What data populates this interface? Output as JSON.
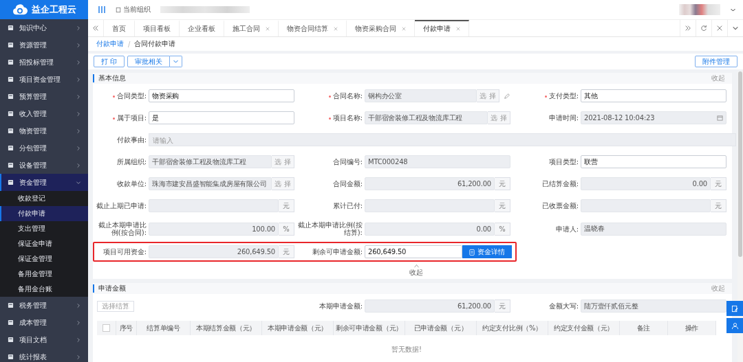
{
  "brand": {
    "name": "益企工程云"
  },
  "header": {
    "org_label": "当前组织"
  },
  "sidebar": {
    "items": [
      {
        "label": "知识中心",
        "expanded": false
      },
      {
        "label": "资源管理",
        "expanded": false
      },
      {
        "label": "招投标管理",
        "expanded": false
      },
      {
        "label": "项目资金管理",
        "expanded": false
      },
      {
        "label": "预算管理",
        "expanded": false
      },
      {
        "label": "收入管理",
        "expanded": false
      },
      {
        "label": "物资管理",
        "expanded": false
      },
      {
        "label": "分包管理",
        "expanded": false
      },
      {
        "label": "设备管理",
        "expanded": false
      },
      {
        "label": "资金管理",
        "expanded": true,
        "children": [
          {
            "label": "收款登记",
            "selected": false
          },
          {
            "label": "付款申请",
            "selected": true
          },
          {
            "label": "支出管理",
            "selected": false
          },
          {
            "label": "保证金申请",
            "selected": false
          },
          {
            "label": "保证金管理",
            "selected": false
          },
          {
            "label": "备用金管理",
            "selected": false
          },
          {
            "label": "备用金台账",
            "selected": false
          }
        ]
      },
      {
        "label": "税务管理",
        "expanded": false
      },
      {
        "label": "成本管理",
        "expanded": false
      },
      {
        "label": "项目文档",
        "expanded": false
      },
      {
        "label": "统计报表",
        "expanded": false
      }
    ]
  },
  "tabs": [
    {
      "label": "首页",
      "closable": false,
      "selected": false
    },
    {
      "label": "项目看板",
      "closable": false,
      "selected": false
    },
    {
      "label": "企业看板",
      "closable": false,
      "selected": false
    },
    {
      "label": "施工合同",
      "closable": true,
      "selected": false
    },
    {
      "label": "物资合同结算",
      "closable": true,
      "selected": false
    },
    {
      "label": "物资采购合同",
      "closable": true,
      "selected": false
    },
    {
      "label": "付款申请",
      "closable": true,
      "selected": true
    }
  ],
  "breadcrumb": {
    "items": [
      "付款申请",
      "合同付款申请"
    ],
    "separator": "/"
  },
  "toolbar": {
    "buttons": [
      "打 印",
      "审批相关"
    ],
    "attachment_button": "附件管理"
  },
  "basic_info": {
    "title": "基本信息",
    "collapse": "收起",
    "collapse_link": "收起",
    "rows": [
      {
        "highlighted": false,
        "fields": [
          {
            "kind": "text",
            "label": "合同类型:",
            "required": true,
            "value": "物资采购",
            "disabled": false
          },
          {
            "kind": "select",
            "label": "合同名称:",
            "required": true,
            "value": "钢构办公室",
            "disabled": true,
            "button": "选 择",
            "edit": true
          },
          {
            "kind": "text",
            "label": "支付类型:",
            "required": true,
            "value": "其他",
            "disabled": false
          }
        ]
      },
      {
        "highlighted": false,
        "fields": [
          {
            "kind": "text",
            "label": "属于项目:",
            "required": true,
            "value": "是",
            "disabled": false
          },
          {
            "kind": "select",
            "label": "项目名称:",
            "required": true,
            "value": "干部宿舍装修工程及物流库工程",
            "disabled": true,
            "button": "选 择"
          },
          {
            "kind": "date",
            "label": "申请时间:",
            "required": false,
            "value": "2021-08-12 10:04:23",
            "disabled": true
          }
        ]
      },
      {
        "highlighted": false,
        "fields": [
          {
            "kind": "textarea",
            "label": "付款事由:",
            "required": false,
            "placeholder": "请输入",
            "disabled": true
          }
        ]
      },
      {
        "highlighted": false,
        "fields": [
          {
            "kind": "select",
            "label": "所属组织:",
            "required": false,
            "value": "干部宿舍装修工程及物流库工程",
            "disabled": true,
            "button": "选 择"
          },
          {
            "kind": "text",
            "label": "合同编号:",
            "required": false,
            "value": "MTC000248",
            "disabled": true
          },
          {
            "kind": "text",
            "label": "项目类型:",
            "required": false,
            "value": "联营",
            "disabled": false
          }
        ]
      },
      {
        "highlighted": false,
        "fields": [
          {
            "kind": "select",
            "label": "收款单位:",
            "required": false,
            "value": "珠海市建安昌盛智能集成房屋有限公司",
            "disabled": true,
            "button": "选 择"
          },
          {
            "kind": "amount",
            "label": "合同金额:",
            "required": false,
            "value": "61,200.00",
            "unit": "元",
            "disabled": true
          },
          {
            "kind": "amount",
            "label": "已结算金额:",
            "required": false,
            "value": "0.00",
            "unit": "元",
            "disabled": true
          }
        ]
      },
      {
        "highlighted": false,
        "fields": [
          {
            "kind": "amount",
            "label": "截止上期已申请:",
            "required": false,
            "unit": "元",
            "disabled": true
          },
          {
            "kind": "amount",
            "label": "累计已付:",
            "required": false,
            "unit": "元",
            "disabled": true
          },
          {
            "kind": "amount",
            "label": "已收票金额:",
            "required": false,
            "unit": "元",
            "disabled": true
          }
        ]
      },
      {
        "highlighted": false,
        "fields": [
          {
            "kind": "amount",
            "label": "截止本期申请比例(按合同):",
            "required": false,
            "value": "100.00",
            "unit": "%",
            "disabled": true
          },
          {
            "kind": "amount",
            "label": "截止本期申请比例(按结算):",
            "required": false,
            "value": "0.00",
            "unit": "%",
            "disabled": true
          },
          {
            "kind": "text",
            "label": "申请人:",
            "required": false,
            "value": "温晓春",
            "disabled": true
          }
        ]
      },
      {
        "highlighted": true,
        "fields": [
          {
            "kind": "amount",
            "label": "项目可用资金:",
            "required": false,
            "value": "260,649.50",
            "unit": "元",
            "disabled": true
          },
          {
            "kind": "action",
            "label": "剩余可申请金额:",
            "required": false,
            "value": "260,649.50",
            "button": "资金详情",
            "disabled": false
          }
        ]
      }
    ]
  },
  "amount_section": {
    "title": "申请金额",
    "collapse": "收起",
    "select_button": "选择结算",
    "fields": [
      {
        "kind": "amount",
        "label": "本期申请金额:",
        "value": "61,200.00",
        "unit": "元",
        "disabled": true
      },
      {
        "kind": "text",
        "label": "金额大写:",
        "value": "陆万壹仟贰佰元整",
        "disabled": true
      }
    ],
    "table": {
      "select_all_checked": false,
      "columns": [
        "序号",
        "结算单编号",
        "本期结算金额（元）",
        "本期申请金额（元）",
        "剩余可申请金额（元）",
        "已申请金额（元）",
        "约定支付比例（%）",
        "约定支付金额（元）",
        "备注",
        "操作"
      ],
      "empty_text": "暂无数据!"
    }
  }
}
